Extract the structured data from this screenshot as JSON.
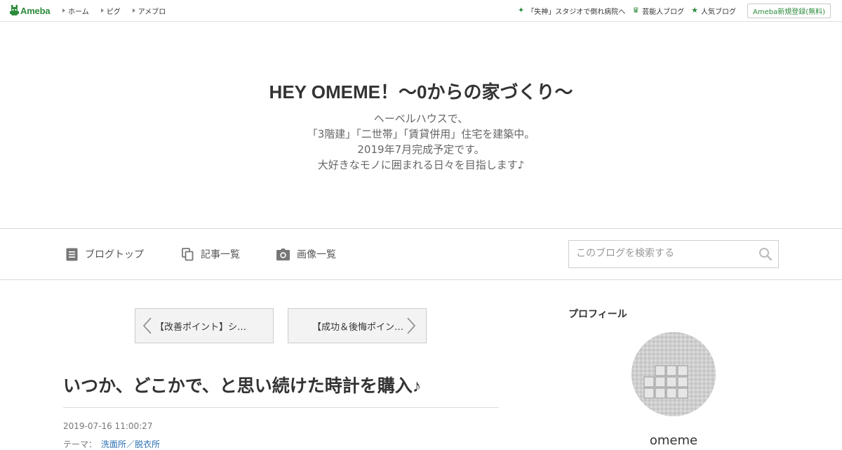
{
  "topbar": {
    "logo_text": "Ameba",
    "nav": [
      "ホーム",
      "ピグ",
      "アメブロ"
    ],
    "right_links": [
      {
        "label": "「失神」スタジオで倒れ病院へ",
        "icon": "sparkle-icon"
      },
      {
        "label": "芸能人ブログ",
        "icon": "crown-icon"
      },
      {
        "label": "人気ブログ",
        "icon": "star-icon"
      }
    ],
    "register_label": "Ameba新規登録(無料)",
    "accent_color": "#2d8c3c"
  },
  "blog": {
    "title": "HEY OMEME！〜0からの家づくり〜",
    "description": [
      "ヘーベルハウスで、",
      "「3階建」「二世帯」「賃貸併用」住宅を建築中。",
      "2019年7月完成予定です。",
      "大好きなモノに囲まれる日々を目指します♪"
    ]
  },
  "nav": {
    "items": [
      {
        "label": "ブログトップ",
        "icon": "document-icon"
      },
      {
        "label": "記事一覧",
        "icon": "copy-icon"
      },
      {
        "label": "画像一覧",
        "icon": "camera-icon"
      }
    ],
    "search_placeholder": "このブログを検索する"
  },
  "pager": {
    "prev_label": "【改善ポイント】シ…",
    "next_label": "【成功＆後悔ポイン…"
  },
  "article": {
    "title": "いつか、どこかで、と思い続けた時計を購入♪",
    "date": "2019-07-16 11:00:27",
    "theme_label": "テーマ：",
    "theme": "洗面所／脱衣所"
  },
  "sidebar": {
    "profile_heading": "プロフィール",
    "name": "omeme"
  }
}
